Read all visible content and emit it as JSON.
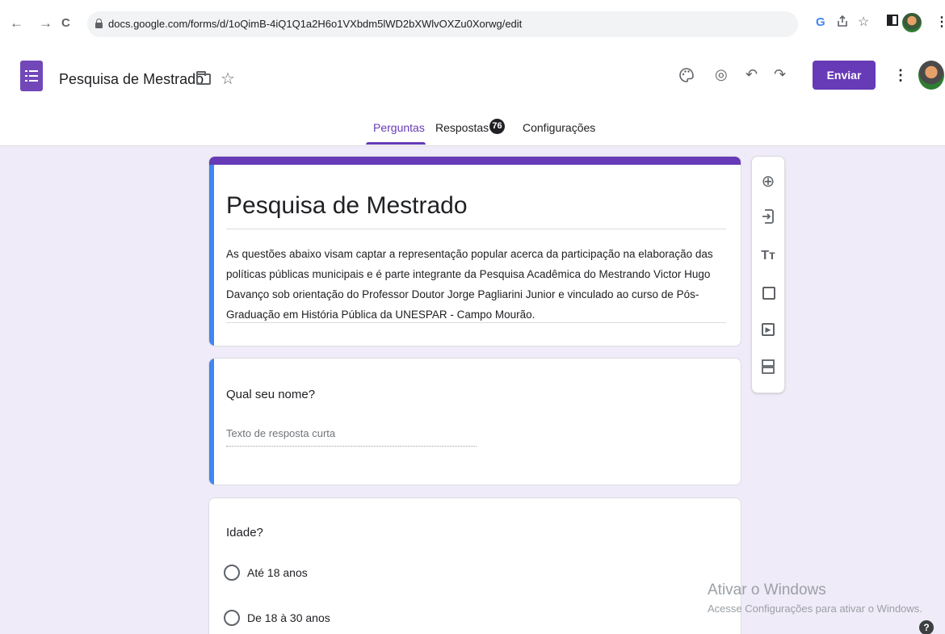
{
  "browser": {
    "back": "←",
    "forward": "→",
    "reload": "C",
    "url": "docs.google.com/forms/d/1oQimB-4iQ1Q1a2H6o1VXbdm5lWD2bXWlvOXZu0Xorwg/edit",
    "icons": [
      "google-g-icon",
      "share-icon",
      "bookmark-star-icon",
      "side-panel-icon",
      "profile-avatar-icon",
      "menu-kebab-icon"
    ],
    "g_label": "G",
    "star": "☆",
    "kebab": "⋮"
  },
  "header": {
    "title": "Pesquisa de Mestrado",
    "star": "☆",
    "palette": "🎨",
    "preview": "◎",
    "undo": "↶",
    "redo": "↷",
    "send_label": "Enviar",
    "kebab": "⋮"
  },
  "tabs": {
    "questions": "Perguntas",
    "responses": "Respostas",
    "responses_count": "76",
    "settings": "Configurações"
  },
  "form": {
    "title": "Pesquisa de Mestrado",
    "description": "As questões abaixo visam captar a representação popular acerca da participação na elaboração das políticas públicas municipais e é parte integrante da Pesquisa Acadêmica do Mestrando Victor Hugo Davanço sob orientação do Professor Doutor Jorge Pagliarini Junior e vinculado ao curso de Pós-Graduação em História Pública da UNESPAR - Campo Mourão.",
    "questions": [
      {
        "text": "Qual seu nome?",
        "placeholder": "Texto de resposta curta"
      },
      {
        "text": "Idade?",
        "options": [
          "Até 18 anos",
          "De 18 à 30 anos"
        ]
      }
    ]
  },
  "toolbar": {
    "add": "⊕",
    "import": "⇥",
    "title_text": "Tт",
    "image": "▣",
    "video": "▶",
    "section": "☰"
  },
  "watermark": {
    "line1": "Ativar o Windows",
    "line2": "Acesse Configurações para ativar o Windows."
  },
  "help": "?"
}
